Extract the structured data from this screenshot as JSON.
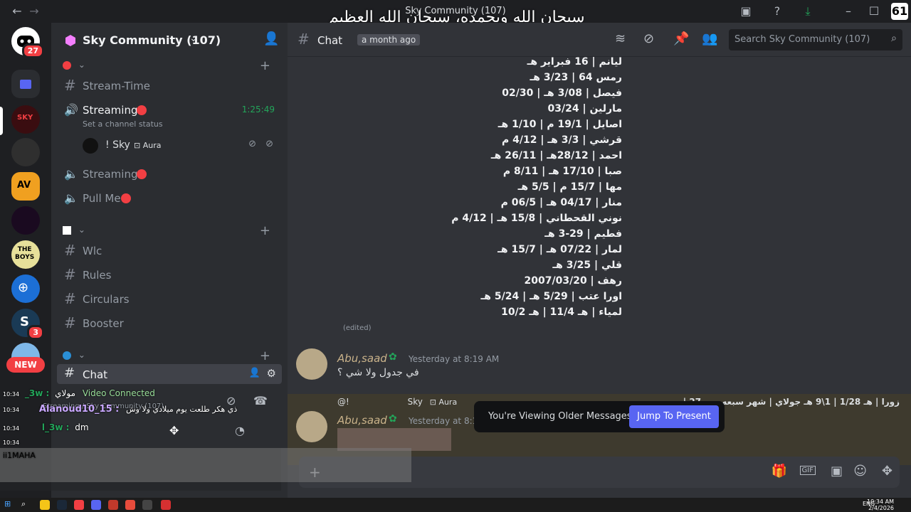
{
  "window": {
    "title": "Sky Community (107)",
    "overlay_text": "سبحان الله وبحمده، سبحان الله العظيم",
    "corner_badge": "61"
  },
  "guilds": {
    "home_badge": "27",
    "badge_s": "3",
    "new_label": "NEW"
  },
  "server": {
    "name": "Sky Community (107)"
  },
  "channels": {
    "stream_time": "Stream-Time",
    "streaming_active": "Streaming",
    "streaming_timer": "1:25:49",
    "channel_status": "Set a channel status",
    "voice_user": "! Sky",
    "voice_user_tag": "Aura",
    "streaming_2": "Streaming",
    "pull_me": "Pull Me",
    "wlc": "Wlc",
    "rules": "Rules",
    "circulars": "Circulars",
    "booster": "Booster",
    "chat": "Chat"
  },
  "header": {
    "channel": "Chat",
    "time_hint": "a month ago",
    "search_placeholder": "Search Sky Community (107)"
  },
  "messages": {
    "list": [
      "ليانم | 16 فبراير هـ",
      "رمس 64 | 3/23 هـ",
      "فيصل | 3/08 هـ | 02/30",
      "مارلين | 03/24",
      "اصايل | 19/1 م | 1/10 هـ",
      "قرشي | 3/3 هـ | 4/12 م",
      "احمد | 28/12هـ | 26/11 هـ",
      "صبا | 17/10 هـ | 8/11 م",
      "مها | 15/7 م | 5/5 هـ",
      "منار | 04/17 هـ | 06/5 م",
      "نوني القحطاني | 15/8 هـ | 4/12 م",
      "فطيم | 29-3 هـ",
      "لمار | 07/22 هـ | 15/7 هـ",
      "قلي | 3/25 هـ",
      "رهف | 2007/03/20",
      "اورا عتب | 5/29 هـ | 5/24 هـ",
      "لمياء | هـ 11/4 | هـ 10/2"
    ],
    "edited": "(edited)",
    "author_1": "Abu,saad",
    "time_1": "Yesterday at 8:19 AM",
    "text_1": "في جدول ولا شي ؟",
    "reply_mention": "@!",
    "reply_user": "Sky",
    "reply_tag": "Aura",
    "reply_text": "زورا | هـ 1/28 | 1\\9 هـ جولاي | شهر سبعه يوم 27 | ...",
    "author_2": "Abu,saad",
    "time_2": "Yesterday at 8:19 AM",
    "older_notice": "You're Viewing Older Messages",
    "jump_label": "Jump To Present"
  },
  "overlay_chat": {
    "time_1": "10:34",
    "user_1": "_3w :",
    "text_1": "مولاي",
    "time_2": "10:34",
    "user_2": "Alanoud10_15 :",
    "text_2": "ذي هكر طلعت يوم ميلادي ولا وش",
    "time_3": "10:34",
    "user_3": "l_3w :",
    "text_3": "dm",
    "time_4": "10:34",
    "user_4": "ii1MAHA",
    "connected": "Video Connected",
    "streaming_line": "Streaming / Sky Community (107)"
  },
  "taskbar": {
    "time": "10:34 AM",
    "date": "2/4/2026",
    "lang": "ENG"
  },
  "colors": {
    "accent": "#5865f2",
    "red": "#f23f43",
    "green": "#23a55a"
  }
}
